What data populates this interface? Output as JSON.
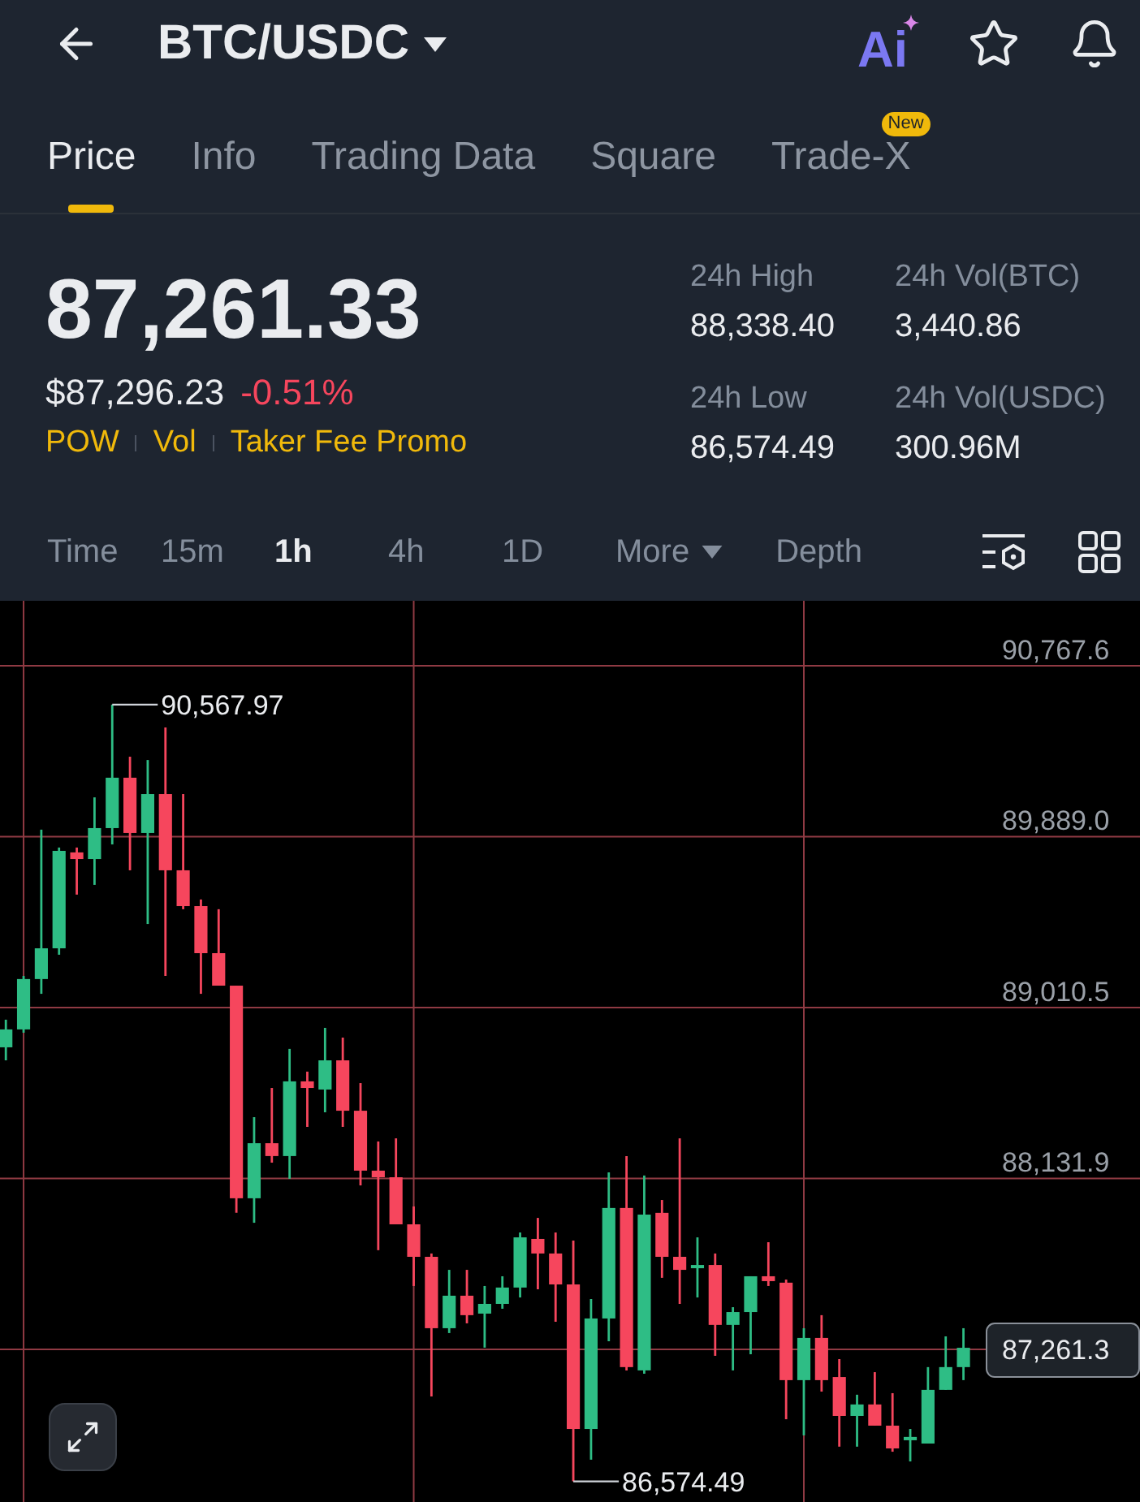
{
  "header": {
    "title": "BTC/USDC",
    "ai_label": "Ai"
  },
  "tabs": [
    {
      "label": "Price",
      "selected": true
    },
    {
      "label": "Info",
      "selected": false
    },
    {
      "label": "Trading Data",
      "selected": false
    },
    {
      "label": "Square",
      "selected": false
    },
    {
      "label": "Trade-X",
      "selected": false,
      "badge": "New"
    }
  ],
  "ticker": {
    "last_price": "87,261.33",
    "usd_price": "$87,296.23",
    "change": "-0.51%",
    "change_negative": true,
    "tags": [
      "POW",
      "Vol",
      "Taker Fee Promo"
    ]
  },
  "stats": [
    {
      "label": "24h High",
      "value": "88,338.40"
    },
    {
      "label": "24h Vol(BTC)",
      "value": "3,440.86"
    },
    {
      "label": "24h Low",
      "value": "86,574.49"
    },
    {
      "label": "24h Vol(USDC)",
      "value": "300.96M"
    }
  ],
  "intervals": [
    {
      "label": "Time",
      "kind": "option",
      "selected": false
    },
    {
      "label": "15m",
      "kind": "option",
      "selected": false
    },
    {
      "label": "1h",
      "kind": "option",
      "selected": true
    },
    {
      "label": "4h",
      "kind": "option",
      "selected": false
    },
    {
      "label": "1D",
      "kind": "option",
      "selected": false
    },
    {
      "label": "More",
      "kind": "dropdown",
      "selected": false
    },
    {
      "label": "Depth",
      "kind": "option",
      "selected": false
    }
  ],
  "chart": {
    "high_label": "90,567.97",
    "low_label": "86,574.49",
    "last_price_label": "87,261.3",
    "chart_data": {
      "type": "candlestick",
      "grid": true,
      "categories": [
        null,
        null,
        null,
        null,
        null,
        null,
        null,
        null,
        null,
        null,
        null,
        null,
        null,
        null,
        null,
        null,
        null,
        null,
        null,
        null,
        null,
        null,
        null,
        null,
        null,
        null,
        null,
        null,
        null,
        null,
        null,
        null,
        null,
        null,
        null,
        null,
        null,
        null,
        null,
        null,
        null,
        null,
        null,
        null,
        null,
        null,
        null,
        null,
        null,
        null,
        null,
        null,
        null,
        null,
        null
      ],
      "ohlc": [
        [
          88806,
          88948,
          88739,
          88898
        ],
        [
          88898,
          89173,
          88881,
          89157
        ],
        [
          89157,
          89925,
          89081,
          89315
        ],
        [
          89315,
          89833,
          89282,
          89816
        ],
        [
          89808,
          89833,
          89591,
          89774
        ],
        [
          89774,
          90091,
          89641,
          89933
        ],
        [
          89933,
          90567.97,
          89849,
          90192
        ],
        [
          90192,
          90300,
          89716,
          89908
        ],
        [
          89908,
          90283,
          89440,
          90108
        ],
        [
          90108,
          90450,
          89173,
          89716
        ],
        [
          89716,
          90108,
          89516,
          89532
        ],
        [
          89532,
          89566,
          89081,
          89290
        ],
        [
          89290,
          89516,
          89123,
          89123
        ],
        [
          89123,
          89123,
          87955,
          88030
        ],
        [
          88030,
          88447,
          87904,
          88313
        ],
        [
          88313,
          88597,
          88213,
          88247
        ],
        [
          88247,
          88798,
          88130,
          88631
        ],
        [
          88631,
          88681,
          88397,
          88597
        ],
        [
          88589,
          88906,
          88472,
          88739
        ],
        [
          88739,
          88856,
          88397,
          88480
        ],
        [
          88480,
          88622,
          88096,
          88172
        ],
        [
          88172,
          88322,
          87763,
          88138
        ],
        [
          88138,
          88338,
          87896,
          87896
        ],
        [
          87896,
          87988,
          87579,
          87729
        ],
        [
          87729,
          87746,
          87011,
          87362
        ],
        [
          87362,
          87662,
          87337,
          87529
        ],
        [
          87529,
          87662,
          87387,
          87429
        ],
        [
          87437,
          87579,
          87262,
          87487
        ],
        [
          87487,
          87629,
          87462,
          87571
        ],
        [
          87571,
          87854,
          87520,
          87829
        ],
        [
          87821,
          87929,
          87562,
          87746
        ],
        [
          87746,
          87854,
          87395,
          87587
        ],
        [
          87587,
          87813,
          86574.49,
          86844
        ],
        [
          86844,
          87512,
          86686,
          87412
        ],
        [
          87412,
          88163,
          87295,
          87980
        ],
        [
          87980,
          88247,
          87145,
          87162
        ],
        [
          87145,
          88147,
          87128,
          87946
        ],
        [
          87955,
          88021,
          87621,
          87729
        ],
        [
          87729,
          88338,
          87487,
          87662
        ],
        [
          87671,
          87829,
          87520,
          87687
        ],
        [
          87687,
          87746,
          87220,
          87379
        ],
        [
          87379,
          87470,
          87145,
          87445
        ],
        [
          87445,
          87629,
          87228,
          87629
        ],
        [
          87629,
          87804,
          87579,
          87604
        ],
        [
          87596,
          87612,
          86894,
          87095
        ],
        [
          87095,
          87362,
          86811,
          87312
        ],
        [
          87312,
          87429,
          87036,
          87095
        ],
        [
          87111,
          87203,
          86753,
          86911
        ],
        [
          86911,
          87020,
          86753,
          86970
        ],
        [
          86970,
          87136,
          86861,
          86861
        ],
        [
          86861,
          87028,
          86727,
          86744
        ],
        [
          86786,
          86844,
          86677,
          86803
        ],
        [
          86769,
          87162,
          86769,
          87045
        ],
        [
          87045,
          87320,
          87045,
          87162
        ],
        [
          87162,
          87362,
          87095,
          87261.33
        ]
      ],
      "ylim": [
        86468.5,
        91101.5
      ],
      "yticks": [
        {
          "value": 90767.6,
          "label": "90,767.6"
        },
        {
          "value": 89889.0,
          "label": "89,889.0"
        },
        {
          "value": 89010.5,
          "label": "89,010.5"
        },
        {
          "value": 88131.9,
          "label": "88,131.9"
        }
      ]
    }
  }
}
